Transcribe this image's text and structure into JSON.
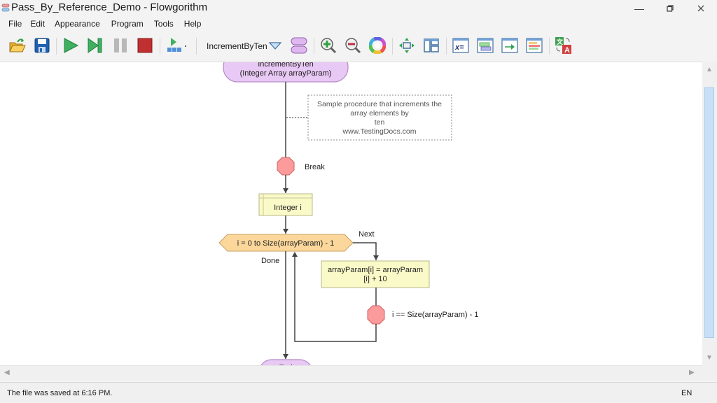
{
  "window": {
    "title": "Pass_By_Reference_Demo - Flowgorithm",
    "minimize_icon": "minimize-icon",
    "maximize_icon": "restore-icon",
    "close_icon": "close-icon"
  },
  "menu": {
    "items": [
      "File",
      "Edit",
      "Appearance",
      "Program",
      "Tools",
      "Help"
    ]
  },
  "toolbar": {
    "buttons": [
      {
        "name": "open-button",
        "icon": "open-folder-icon"
      },
      {
        "name": "save-button",
        "icon": "save-disk-icon"
      },
      {
        "name": "run-button",
        "icon": "play-icon"
      },
      {
        "name": "step-button",
        "icon": "step-icon"
      },
      {
        "name": "pause-button",
        "icon": "pause-icon"
      },
      {
        "name": "stop-button",
        "icon": "stop-icon"
      },
      {
        "name": "run-speed-button",
        "icon": "run-speed-icon"
      },
      {
        "name": "procedure-dropdown",
        "icon": "dropdown-triangle-icon"
      },
      {
        "name": "manage-functions-button",
        "icon": "functions-icon"
      },
      {
        "name": "zoom-in-button",
        "icon": "zoom-in-icon"
      },
      {
        "name": "zoom-out-button",
        "icon": "zoom-out-icon"
      },
      {
        "name": "color-theme-button",
        "icon": "color-wheel-icon"
      },
      {
        "name": "layout-button",
        "icon": "layout-arrows-icon"
      },
      {
        "name": "windows-layout-button",
        "icon": "panels-icon"
      },
      {
        "name": "variable-watch-button",
        "icon": "variable-watch-icon"
      },
      {
        "name": "source-code-button",
        "icon": "source-code-icon"
      },
      {
        "name": "console-button",
        "icon": "console-icon"
      },
      {
        "name": "chart-button",
        "icon": "chart-window-icon"
      },
      {
        "name": "translate-button",
        "icon": "translate-icon"
      }
    ],
    "procedure_selected": "IncrementByTen"
  },
  "flowchart": {
    "start_line1": "IncrementByTen",
    "start_line2": "(Integer Array arrayParam)",
    "comment_lines": [
      "Sample procedure that increments the",
      "array elements by",
      "ten",
      "www.TestingDocs.com"
    ],
    "break1_label": "Break",
    "declare_label": "Integer i",
    "for_label": "i = 0 to Size(arrayParam) - 1",
    "next_label": "Next",
    "done_label": "Done",
    "assign_line1": "arrayParam[i] = arrayParam",
    "assign_line2": "[i] + 10",
    "break2_label": "i == Size(arrayParam) - 1",
    "end_label": "End",
    "colors": {
      "terminal_fill": "#e8c8f4",
      "terminal_stroke": "#b58ac6",
      "break_fill": "#fb9b9b",
      "break_stroke": "#d06060",
      "process_fill": "#fafac8",
      "process_stroke": "#b8b888",
      "loop_fill": "#fbd79b",
      "loop_stroke": "#c8a060"
    }
  },
  "status": {
    "message": "The file was saved at 6:16 PM.",
    "language": "EN"
  }
}
